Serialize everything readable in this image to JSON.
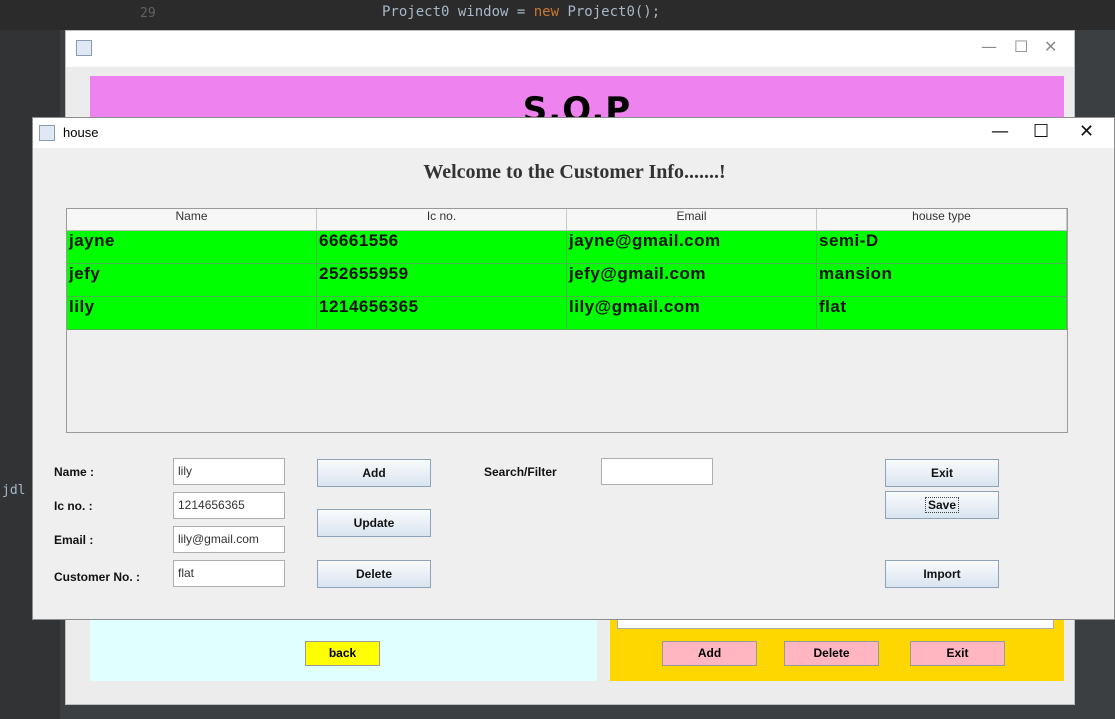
{
  "ide": {
    "line_number": "29",
    "code_before": "Project0 window = ",
    "code_keyword": "new",
    "code_after": " Project0();",
    "left_text": "jdl"
  },
  "back_window": {
    "banner_title": "S.O.P",
    "back_label": "back",
    "add_label": "Add",
    "delete_label": "Delete",
    "exit_label": "Exit",
    "colors": {
      "banner": "#ee82ee",
      "left_panel": "#e0ffff",
      "right_panel": "#ffd700",
      "back_button": "#ffff00",
      "pink_buttons": "#ffb6c1"
    }
  },
  "front_window": {
    "title": "house",
    "controls": {
      "minimize": "—",
      "maximize": "☐",
      "close": "✕"
    },
    "welcome": "Welcome to the Customer Info.......!",
    "table": {
      "columns": [
        "Name",
        "Ic no.",
        "Email",
        "house type"
      ],
      "rows": [
        [
          "jayne",
          "66661556",
          "jayne@gmail.com",
          "semi-D"
        ],
        [
          "jefy",
          "252655959",
          "jefy@gmail.com",
          "mansion"
        ],
        [
          "lily",
          "1214656365",
          "lily@gmail.com",
          "flat"
        ]
      ],
      "row_color": "#00ff00"
    },
    "form": {
      "name_label": "Name :",
      "name_value": "lily",
      "ic_label": "Ic no. :",
      "ic_value": "1214656365",
      "email_label": "Email :",
      "email_value": "lily@gmail.com",
      "customer_label": "Customer No. :",
      "customer_value": "flat",
      "search_label": "Search/Filter",
      "search_value": ""
    },
    "buttons": {
      "add": "Add",
      "update": "Update",
      "delete": "Delete",
      "exit": "Exit",
      "save": "Save",
      "import": "Import"
    }
  }
}
